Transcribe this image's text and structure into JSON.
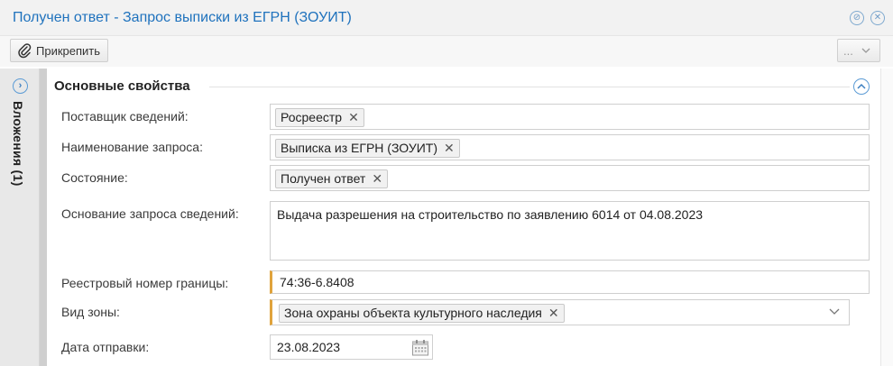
{
  "window": {
    "title": "Получен ответ - Запрос выписки из ЕГРН (ЗОУИТ)"
  },
  "toolbar": {
    "attach_label": "Прикрепить",
    "more_label": "..."
  },
  "side_panel": {
    "label": "Вложения (1)"
  },
  "section": {
    "title": "Основные свойства"
  },
  "fields": {
    "supplier": {
      "label": "Поставщик сведений:",
      "value": "Росреестр"
    },
    "request_name": {
      "label": "Наименование запроса:",
      "value": "Выписка из ЕГРН (ЗОУИТ)"
    },
    "state": {
      "label": "Состояние:",
      "value": "Получен ответ"
    },
    "basis": {
      "label": "Основание запроса сведений:",
      "value": "Выдача разрешения на строительство по заявлению 6014 от 04.08.2023"
    },
    "registry_number": {
      "label": "Реестровый номер границы:",
      "value": "74:36-6.8408"
    },
    "zone_type": {
      "label": "Вид зоны:",
      "value": "Зона охраны объекта культурного наследия"
    },
    "send_date": {
      "label": "Дата отправки:",
      "value": "23.08.2023"
    }
  },
  "colors": {
    "title": "#1f72bd",
    "accent_icon": "#5b9bd5",
    "required_marker": "#e0a33c"
  },
  "icons": [
    "minimize-icon",
    "close-icon",
    "paperclip-icon",
    "chevron-down-icon",
    "expand-panel-icon",
    "collapse-section-icon",
    "remove-tag-icon",
    "calendar-icon"
  ]
}
